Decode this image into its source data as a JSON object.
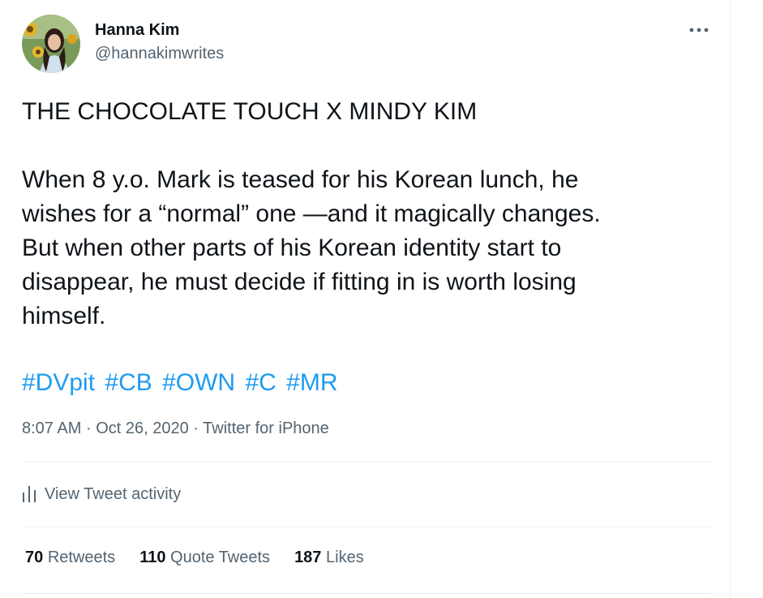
{
  "author": {
    "name": "Hanna Kim",
    "handle": "@hannakimwrites",
    "avatar_icon": "profile-photo-with-sunflower"
  },
  "more_icon": "ellipsis-icon",
  "tweet": {
    "text": "THE CHOCOLATE TOUCH X MINDY KIM\n\nWhen 8 y.o. Mark is teased for his Korean lunch, he\nwishes for a “normal” one —and it magically changes.\nBut when other parts of his Korean identity start to\ndisappear, he must decide if fitting in is worth losing\nhimself.",
    "hashtags": [
      "#DVpit",
      "#CB",
      "#OWN",
      "#C",
      "#MR"
    ]
  },
  "meta": {
    "time": "8:07 AM",
    "separator": "·",
    "date": "Oct 26, 2020",
    "source": "Twitter for iPhone"
  },
  "activity": {
    "label": "View Tweet activity",
    "icon": "bar-chart-icon"
  },
  "stats": {
    "retweets": {
      "count": "70",
      "label": "Retweets"
    },
    "quotes": {
      "count": "110",
      "label": "Quote Tweets"
    },
    "likes": {
      "count": "187",
      "label": "Likes"
    }
  },
  "colors": {
    "link": "#1d9bf0",
    "secondary_text": "#536471",
    "primary_text": "#0f1419",
    "divider": "#eff3f4"
  }
}
